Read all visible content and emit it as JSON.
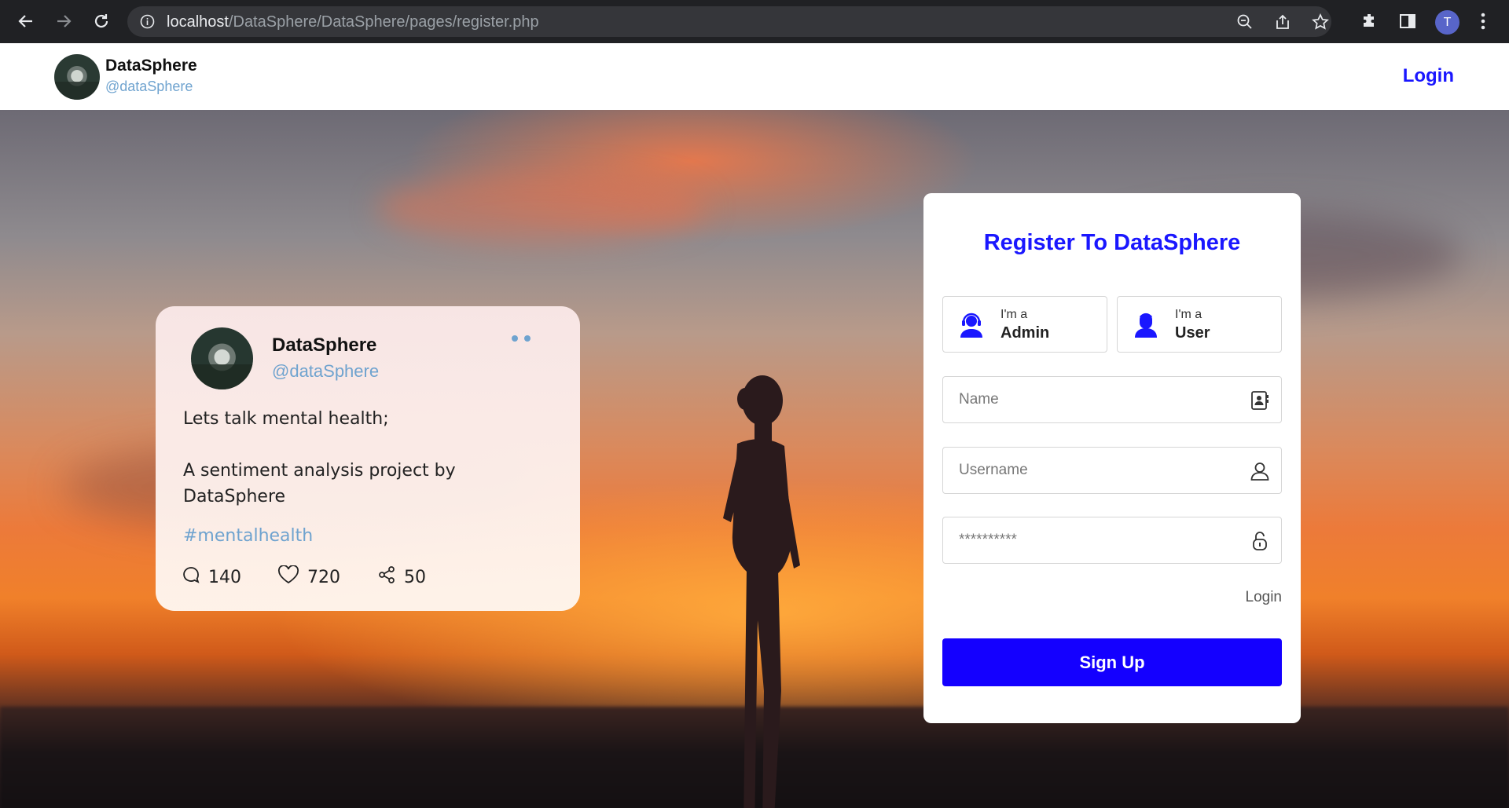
{
  "browser": {
    "url_host": "localhost",
    "url_path": "/DataSphere/DataSphere/pages/register.php",
    "profile_initial": "T"
  },
  "header": {
    "brand_name": "DataSphere",
    "brand_handle": "@dataSphere",
    "login_label": "Login"
  },
  "post": {
    "name": "DataSphere",
    "handle": "@dataSphere",
    "line1": "Lets talk mental health;",
    "line2": "A sentiment analysis project by",
    "line3": "DataSphere",
    "hashtag": "#mentalhealth",
    "comments": "140",
    "likes": "720",
    "shares": "50"
  },
  "register": {
    "title": "Register To DataSphere",
    "roles": [
      {
        "pre": "I'm a",
        "label": "Admin"
      },
      {
        "pre": "I'm a",
        "label": "User"
      }
    ],
    "name_placeholder": "Name",
    "username_placeholder": "Username",
    "password_placeholder": "**********",
    "login_link": "Login",
    "signup_label": "Sign Up"
  },
  "colors": {
    "accent": "#1400ff",
    "title": "#1a17ff",
    "handle": "#6fa3cf"
  }
}
